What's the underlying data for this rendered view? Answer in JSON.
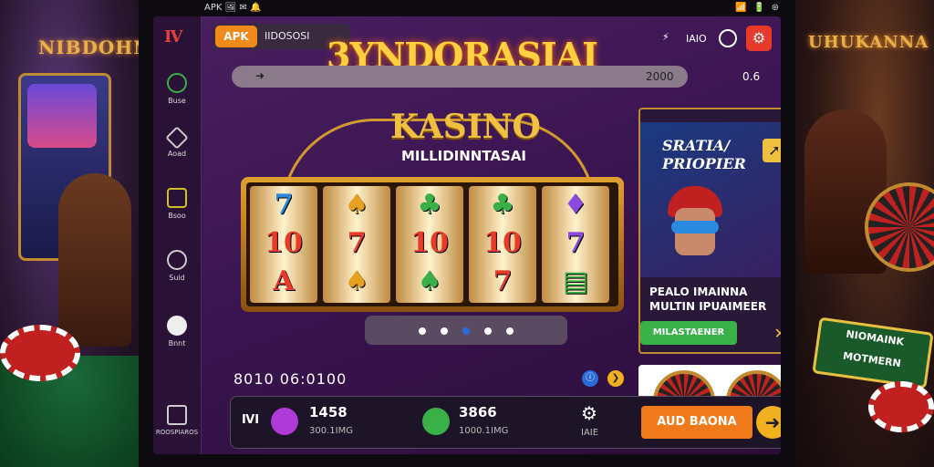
{
  "status_bar": {
    "left": "APK 🖼 ✉ 🔔",
    "left_signal": "APK",
    "right": "📶 🔋 ⊛",
    "right2": "📶 🔋 📶"
  },
  "background": {
    "left_sign": "NIBDOHNE",
    "right_sign": "UHUKANNA",
    "right_badge": "NIOMAINK\nMOTMERN"
  },
  "sidebar": {
    "logo": "Ⅳ",
    "items": [
      {
        "label": "Buse"
      },
      {
        "label": "Aoad"
      },
      {
        "label": "Bsoo"
      },
      {
        "label": "Suid"
      },
      {
        "label": "Bnnt"
      },
      {
        "label": "ROOSPIAROS"
      }
    ]
  },
  "header": {
    "apk_label": "APK",
    "apk_text": "IIDOSOSI",
    "brand": "3YNDORASIAI",
    "icon_label": "IAIO",
    "search_symbol": "⚡"
  },
  "balance": {
    "value": "2000",
    "secondary": "0.6"
  },
  "game": {
    "title": "KASINO",
    "subtitle": "MILLIDINNTASAI",
    "reels": [
      [
        "7",
        "10",
        "A"
      ],
      [
        "♠",
        "7",
        "♠"
      ],
      [
        "♣",
        "10",
        "♠"
      ],
      [
        "♣",
        "10",
        "7"
      ],
      [
        "♦",
        "7",
        "▤"
      ]
    ],
    "reel_colors": [
      [
        "#2a8ae0",
        "#e83a2a",
        "#e83a2a"
      ],
      [
        "#e8a020",
        "#e83a2a",
        "#e8a020"
      ],
      [
        "#3ab048",
        "#e83a2a",
        "#3ab048"
      ],
      [
        "#3ab048",
        "#e83a2a",
        "#e83a2a"
      ],
      [
        "#8a4ae0",
        "#8a4ae0",
        "#3ab048"
      ]
    ],
    "carousel_dots": 5,
    "active_dot": 2
  },
  "timer": "8010 06:0100",
  "promo": {
    "title_line1": "SRATIA/",
    "title_line2": "PRIOPIER",
    "body_line1": "PEALO IMAINNA",
    "body_line2": "MULTIN IPUAIMEER",
    "button": "MILASTAENER",
    "close": "✕"
  },
  "bottom": {
    "left_label": "ⅣⅠ",
    "stat1_value": "1458",
    "stat1_label": "300.1IMG",
    "stat2_value": "3866",
    "stat2_label": "1000.1IMG",
    "settings_label": "IAIE",
    "play_button": "AUD BAONA",
    "play_arrow": "➜"
  },
  "colors": {
    "accent": "#f07a1a",
    "brand_gold": "#ffd040",
    "screen_purple": "#3a1450",
    "green": "#3ab048",
    "red": "#e83a2a"
  }
}
